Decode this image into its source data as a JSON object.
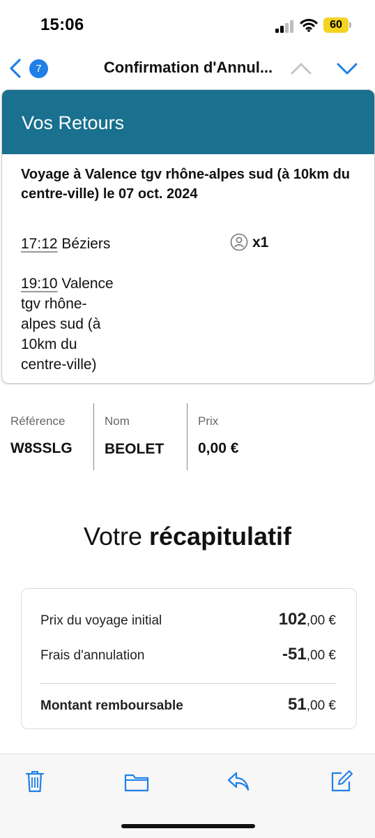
{
  "status_bar": {
    "time": "15:06",
    "battery": "60"
  },
  "nav": {
    "unread_count": "7",
    "title": "Confirmation d'Annul..."
  },
  "card": {
    "header": "Vos Retours",
    "trip_title": "Voyage à Valence tgv rhône-alpes sud (à 10km du centre-ville) le 07 oct. 2024",
    "departure_time": "17:12",
    "departure_station": "Béziers",
    "passengers": "x1",
    "arrival_time": "19:10",
    "arrival_station_lines": [
      "Valence",
      "tgv rhône-",
      "alpes sud (à",
      "10km du",
      "centre-ville)"
    ]
  },
  "booking": {
    "reference_label": "Référence",
    "reference_value": "W8SSLG",
    "name_label": "Nom",
    "name_value": "BEOLET",
    "price_label": "Prix",
    "price_value": "0,00 €"
  },
  "recap": {
    "title_normal": "Votre ",
    "title_bold": "récapitulatif",
    "rows": [
      {
        "label": "Prix du voyage initial",
        "amount_main": "102",
        "amount_rest": ",00 €"
      },
      {
        "label": "Frais d'annulation",
        "amount_main": "-51",
        "amount_rest": ",00 €"
      }
    ],
    "total": {
      "label": "Montant remboursable",
      "amount_main": "51",
      "amount_rest": ",00 €"
    }
  },
  "toolbar": {
    "icons": [
      "trash-icon",
      "folder-icon",
      "reply-icon",
      "compose-icon"
    ]
  },
  "colors": {
    "header_teal": "#19708f",
    "ios_blue": "#1f7fe6",
    "battery_yellow": "#f4d322"
  }
}
